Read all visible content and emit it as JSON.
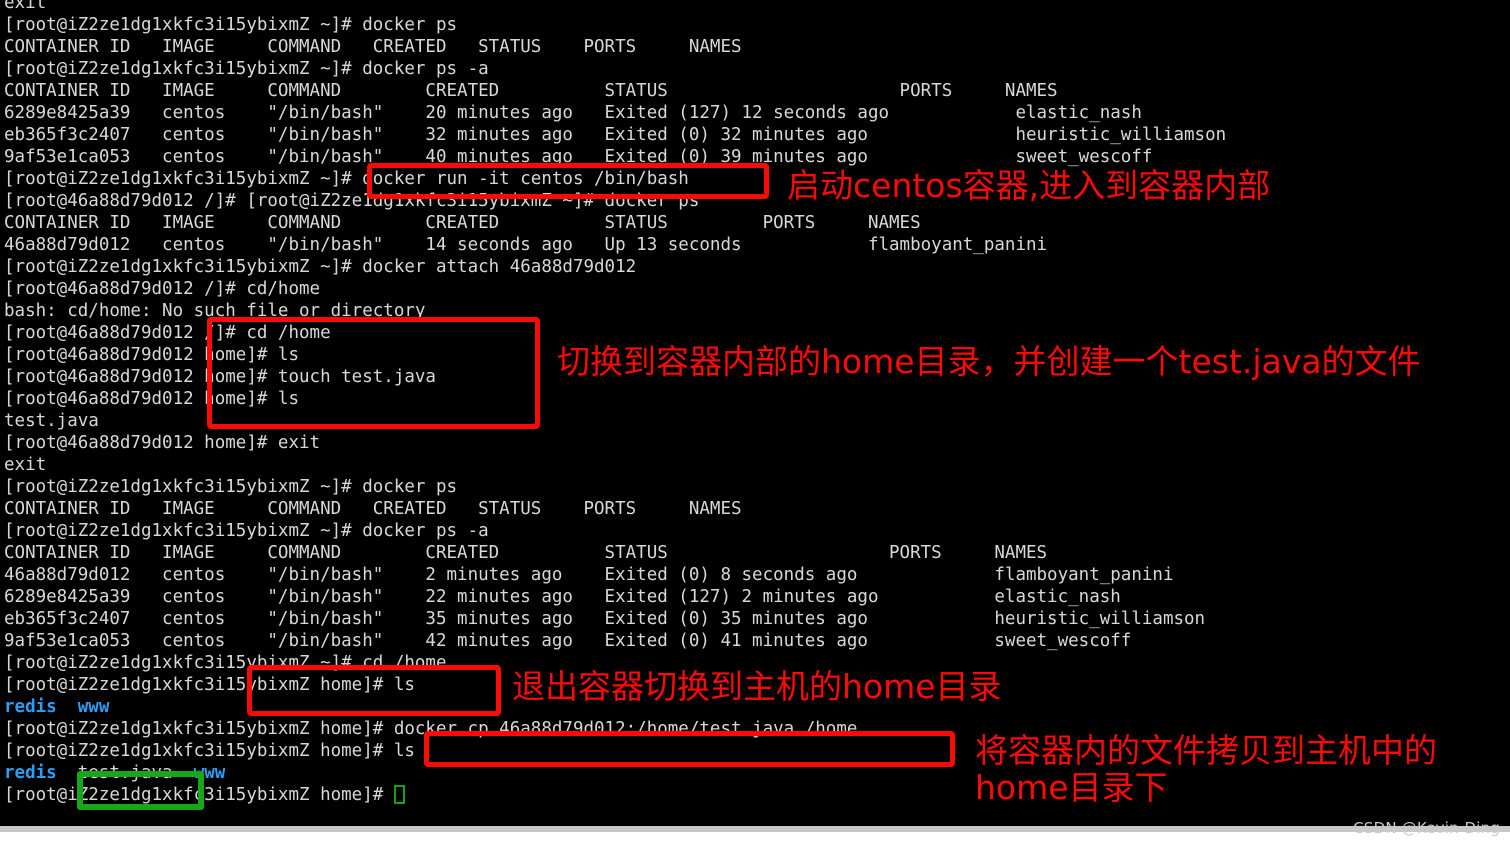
{
  "terminal": {
    "background_color": "#000000",
    "foreground_color": "#d8d8d8",
    "directory_color": "#2e9ef4",
    "host_prompt": "[root@iZ2ze1dg1xkfc3i15ybixmZ ~]#",
    "host_prompt_home": "[root@iZ2ze1dg1xkfc3i15ybixmZ home]#",
    "container_prompt_root": "[root@46a88d79d012 /]#",
    "container_prompt_home": "[root@46a88d79d012 home]#",
    "lines": [
      {
        "id": "l01",
        "text": "exit"
      },
      {
        "id": "l02",
        "text": "[root@iZ2ze1dg1xkfc3i15ybixmZ ~]# docker ps"
      },
      {
        "id": "l03",
        "text": "CONTAINER ID   IMAGE     COMMAND   CREATED   STATUS    PORTS     NAMES"
      },
      {
        "id": "l04",
        "text": "[root@iZ2ze1dg1xkfc3i15ybixmZ ~]# docker ps -a"
      },
      {
        "id": "l05",
        "text": "CONTAINER ID   IMAGE     COMMAND        CREATED          STATUS                      PORTS     NAMES"
      },
      {
        "id": "l06",
        "text": "6289e8425a39   centos    \"/bin/bash\"    20 minutes ago   Exited (127) 12 seconds ago            elastic_nash"
      },
      {
        "id": "l07",
        "text": "eb365f3c2407   centos    \"/bin/bash\"    32 minutes ago   Exited (0) 32 minutes ago              heuristic_williamson"
      },
      {
        "id": "l08",
        "text": "9af53e1ca053   centos    \"/bin/bash\"    40 minutes ago   Exited (0) 39 minutes ago              sweet_wescoff"
      },
      {
        "id": "l09",
        "text": "[root@iZ2ze1dg1xkfc3i15ybixmZ ~]# docker run -it centos /bin/bash"
      },
      {
        "id": "l10",
        "text": "[root@46a88d79d012 /]# [root@iZ2ze1dg1xkfc3i15ybixmZ ~]# docker ps"
      },
      {
        "id": "l11",
        "text": "CONTAINER ID   IMAGE     COMMAND        CREATED          STATUS         PORTS     NAMES"
      },
      {
        "id": "l12",
        "text": "46a88d79d012   centos    \"/bin/bash\"    14 seconds ago   Up 13 seconds            flamboyant_panini"
      },
      {
        "id": "l13",
        "text": "[root@iZ2ze1dg1xkfc3i15ybixmZ ~]# docker attach 46a88d79d012"
      },
      {
        "id": "l14",
        "text": "[root@46a88d79d012 /]# cd/home"
      },
      {
        "id": "l15",
        "text": "bash: cd/home: No such file or directory"
      },
      {
        "id": "l16",
        "text": "[root@46a88d79d012 /]# cd /home"
      },
      {
        "id": "l17",
        "text": "[root@46a88d79d012 home]# ls"
      },
      {
        "id": "l18",
        "text": "[root@46a88d79d012 home]# touch test.java"
      },
      {
        "id": "l19",
        "text": "[root@46a88d79d012 home]# ls"
      },
      {
        "id": "l20",
        "text": "test.java"
      },
      {
        "id": "l21",
        "text": "[root@46a88d79d012 home]# exit"
      },
      {
        "id": "l22",
        "text": "exit"
      },
      {
        "id": "l23",
        "text": "[root@iZ2ze1dg1xkfc3i15ybixmZ ~]# docker ps"
      },
      {
        "id": "l24",
        "text": "CONTAINER ID   IMAGE     COMMAND   CREATED   STATUS    PORTS     NAMES"
      },
      {
        "id": "l25",
        "text": "[root@iZ2ze1dg1xkfc3i15ybixmZ ~]# docker ps -a"
      },
      {
        "id": "l26",
        "text": "CONTAINER ID   IMAGE     COMMAND        CREATED          STATUS                     PORTS     NAMES"
      },
      {
        "id": "l27",
        "text": "46a88d79d012   centos    \"/bin/bash\"    2 minutes ago    Exited (0) 8 seconds ago             flamboyant_panini"
      },
      {
        "id": "l28",
        "text": "6289e8425a39   centos    \"/bin/bash\"    22 minutes ago   Exited (127) 2 minutes ago           elastic_nash"
      },
      {
        "id": "l29",
        "text": "eb365f3c2407   centos    \"/bin/bash\"    35 minutes ago   Exited (0) 35 minutes ago            heuristic_williamson"
      },
      {
        "id": "l30",
        "text": "9af53e1ca053   centos    \"/bin/bash\"    42 minutes ago   Exited (0) 41 minutes ago            sweet_wescoff"
      },
      {
        "id": "l31",
        "text": "[root@iZ2ze1dg1xkfc3i15ybixmZ ~]# cd /home"
      },
      {
        "id": "l32",
        "text": "[root@iZ2ze1dg1xkfc3i15ybixmZ home]# ls"
      },
      {
        "id": "l33",
        "text": ""
      },
      {
        "id": "l34",
        "text": "[root@iZ2ze1dg1xkfc3i15ybixmZ home]# docker cp 46a88d79d012:/home/test.java /home"
      },
      {
        "id": "l35",
        "text": "[root@iZ2ze1dg1xkfc3i15ybixmZ home]# ls"
      },
      {
        "id": "l36",
        "text": ""
      },
      {
        "id": "l37",
        "text": "[root@iZ2ze1dg1xkfc3i15ybixmZ home]# "
      }
    ],
    "ls_output_before": {
      "dir1": "redis",
      "dir2": "www"
    },
    "ls_output_after": {
      "dir1": "redis",
      "file": "test.java",
      "dir2": "www"
    }
  },
  "annotations": {
    "color": "#fb0b05",
    "highlight_color": "#17a81a",
    "notes": [
      {
        "id": "n1",
        "text": "启动centos容器,进入到容器内部"
      },
      {
        "id": "n2",
        "text": "切换到容器内部的home目录，并创建一个test.java的文件"
      },
      {
        "id": "n3",
        "text": "退出容器切换到主机的home目录"
      },
      {
        "id": "n4",
        "text": "将容器内的文件拷贝到主机中的\nhome目录下"
      }
    ],
    "boxes": [
      {
        "id": "b1",
        "label": "docker-run-box"
      },
      {
        "id": "b2",
        "label": "container-home-commands-box"
      },
      {
        "id": "b3",
        "label": "host-cd-home-box"
      },
      {
        "id": "b4",
        "label": "docker-cp-box"
      },
      {
        "id": "g1",
        "label": "test-java-highlight-box"
      }
    ]
  },
  "watermark": {
    "text": "CSDN @Kevin-Ding"
  }
}
